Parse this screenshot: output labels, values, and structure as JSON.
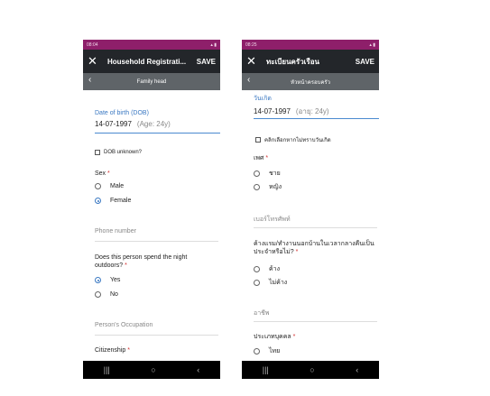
{
  "screens": [
    {
      "status_time": "08:04",
      "close_icon": "close-icon",
      "title": "Household Registrati...",
      "save": "SAVE",
      "subheader": "Family head",
      "dob_label": "Date of birth (DOB)",
      "dob_value": "14-07-1997",
      "age": "(Age: 24y)",
      "dob_unknown": "DOB unknown?",
      "sex_label": "Sex",
      "sex_options": [
        "Male",
        "Female"
      ],
      "sex_selected": 1,
      "phone": "Phone number",
      "night_q": "Does this person spend the night outdoors?",
      "night_options": [
        "Yes",
        "No"
      ],
      "night_selected": 0,
      "occupation": "Person's Occupation",
      "citizenship": "Citizenship",
      "citizen_option": ""
    },
    {
      "status_time": "08:25",
      "close_icon": "close-icon",
      "title": "ทะเบียนครัวเรือน",
      "save": "SAVE",
      "subheader": "หัวหน้าครอบครัว",
      "dob_label": "วันเกิด",
      "dob_value": "14-07-1997",
      "age": "(อายุ: 24y)",
      "dob_unknown": "คลิกเลือกหากไม่ทราบวันเกิด",
      "sex_label": "เพศ",
      "sex_options": [
        "ชาย",
        "หญิง"
      ],
      "sex_selected": -1,
      "phone": "เบอร์โทรศัพท์",
      "night_q": "ค้างแรม/ทำงานนอกบ้านในเวลากลางคืนเป็นประจำหรือไม่?",
      "night_options": [
        "ค้าง",
        "ไม่ค้าง"
      ],
      "night_selected": -1,
      "occupation": "อาชีพ",
      "citizenship": "ประเภทบุคคล",
      "citizen_option": "ไทย"
    }
  ],
  "nav": {
    "recents": "|||",
    "home": "○",
    "back": "‹"
  },
  "colors": {
    "status": "#8e1f6a",
    "appbar": "#23262a",
    "subbar": "#5f6468",
    "accent": "#3a78c2",
    "required": "#d32f2f"
  }
}
